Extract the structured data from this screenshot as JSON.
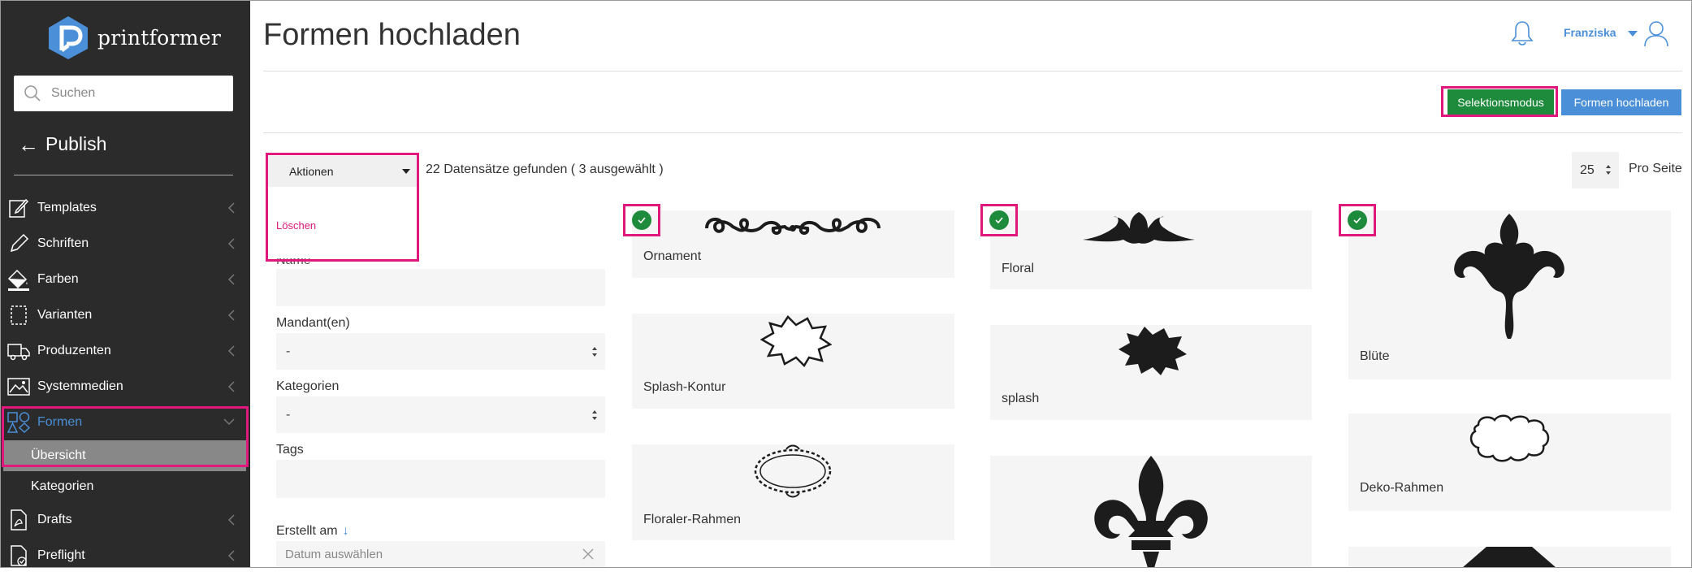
{
  "brand": {
    "name": "printformer"
  },
  "search": {
    "placeholder": "Suchen",
    "icon": "search-icon"
  },
  "back": {
    "label": "Publish",
    "icon": "arrow-left-icon"
  },
  "nav": {
    "items": [
      {
        "label": "Templates",
        "icon": "edit-icon"
      },
      {
        "label": "Schriften",
        "icon": "pencil-icon"
      },
      {
        "label": "Farben",
        "icon": "paint-bucket-icon"
      },
      {
        "label": "Varianten",
        "icon": "document-icon"
      },
      {
        "label": "Produzenten",
        "icon": "truck-icon"
      },
      {
        "label": "Systemmedien",
        "icon": "image-icon"
      },
      {
        "label": "Formen",
        "icon": "shapes-icon",
        "active": true
      }
    ],
    "sub_items": [
      {
        "label": "Übersicht",
        "selected": true
      },
      {
        "label": "Kategorien"
      }
    ],
    "items_after": [
      {
        "label": "Drafts",
        "icon": "pdf-icon"
      },
      {
        "label": "Preflight",
        "icon": "preflight-icon"
      }
    ]
  },
  "header": {
    "title": "Formen hochladen",
    "user_name": "Franziska",
    "bell_icon": "bell-icon",
    "user_icon": "user-icon"
  },
  "toolbar": {
    "selection_mode_label": "Selektionsmodus",
    "upload_label": "Formen hochladen"
  },
  "actions": {
    "label": "Aktionen",
    "options": [
      "Löschen"
    ]
  },
  "records_text": "22 Datensätze gefunden ( 3 ausgewählt )",
  "per_page": {
    "value": "25",
    "label": "Pro Seite"
  },
  "filters": {
    "mandant_label": "Mandant(en)",
    "mandant_value": "-",
    "kategorien_label": "Kategorien",
    "kategorien_value": "-",
    "tags_label": "Tags",
    "created_label": "Erstellt am",
    "created_sort": "↓",
    "date_placeholder": "Datum auswählen"
  },
  "shapes": [
    {
      "name": "Ornament",
      "selected": true
    },
    {
      "name": "Splash-Kontur",
      "selected": false
    },
    {
      "name": "Floraler-Rahmen",
      "selected": false
    },
    {
      "name": "Floral",
      "selected": true
    },
    {
      "name": "splash",
      "selected": false
    },
    {
      "name": "Blüte",
      "selected": true
    },
    {
      "name": "Deko-Rahmen",
      "selected": false
    }
  ],
  "colors": {
    "sidebar_bg": "#2b2b2b",
    "accent_blue": "#4a8fd8",
    "green": "#1e8a3c",
    "highlight_pink": "#e0177c",
    "danger": "#e0177c"
  }
}
